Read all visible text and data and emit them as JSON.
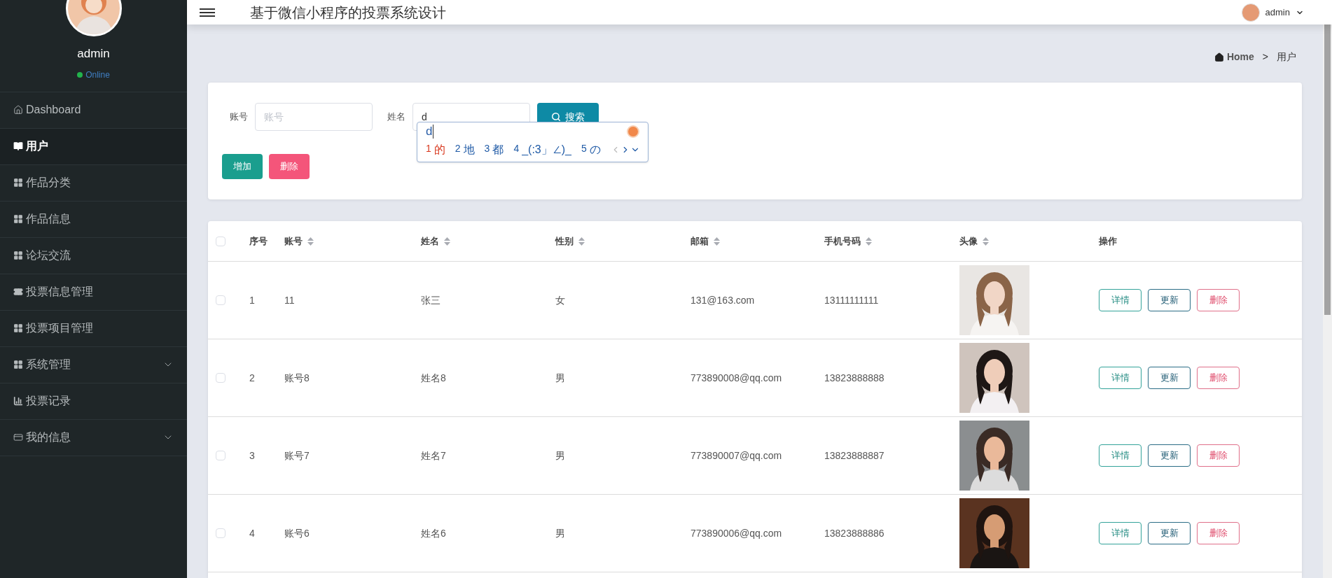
{
  "header": {
    "title": "基于微信小程序的投票系统设计",
    "user": "admin"
  },
  "sidebar": {
    "user": {
      "name": "admin",
      "status": "Online",
      "online": true
    },
    "items": [
      {
        "label": "Dashboard",
        "kind": "home",
        "selected": false,
        "expandable": false
      },
      {
        "label": "用户",
        "kind": "book",
        "selected": true,
        "expandable": false
      },
      {
        "label": "作品分类",
        "kind": "grid",
        "selected": false,
        "expandable": false
      },
      {
        "label": "作品信息",
        "kind": "grid",
        "selected": false,
        "expandable": false
      },
      {
        "label": "论坛交流",
        "kind": "grid",
        "selected": false,
        "expandable": false
      },
      {
        "label": "投票信息管理",
        "kind": "ticket",
        "selected": false,
        "expandable": false
      },
      {
        "label": "投票项目管理",
        "kind": "grid",
        "selected": false,
        "expandable": false
      },
      {
        "label": "系统管理",
        "kind": "grid",
        "selected": false,
        "expandable": true
      },
      {
        "label": "投票记录",
        "kind": "chart",
        "selected": false,
        "expandable": false
      },
      {
        "label": "我的信息",
        "kind": "card",
        "selected": false,
        "expandable": true
      }
    ]
  },
  "breadcrumb": [
    "Home",
    ">",
    "用户"
  ],
  "search": {
    "fields": [
      {
        "label": "账号",
        "placeholder": "账号"
      },
      {
        "label": "姓名",
        "value": "d"
      }
    ],
    "button": "搜索"
  },
  "actions": [
    {
      "label": "增加",
      "kind": "add"
    },
    {
      "label": "删除",
      "kind": "delete"
    }
  ],
  "ime": {
    "input": "d",
    "candidates": [
      {
        "index": "1",
        "text": "的",
        "selected": true
      },
      {
        "index": "2",
        "text": "地",
        "selected": false
      },
      {
        "index": "3",
        "text": "都",
        "selected": false
      },
      {
        "index": "4",
        "text": "_(:3」∠)_",
        "selected": false
      },
      {
        "index": "5",
        "text": "の",
        "selected": false
      }
    ]
  },
  "table": {
    "all_checked": false,
    "columns": [
      {
        "label": "序号",
        "sortable": false
      },
      {
        "label": "账号",
        "sortable": true
      },
      {
        "label": "姓名",
        "sortable": true
      },
      {
        "label": "性别",
        "sortable": true
      },
      {
        "label": "邮箱",
        "sortable": true
      },
      {
        "label": "手机号码",
        "sortable": true
      },
      {
        "label": "头像",
        "sortable": true
      },
      {
        "label": "操作",
        "sortable": false
      }
    ],
    "rows": [
      {
        "checked": false,
        "cells": [
          "1",
          "11",
          "张三",
          "女",
          "131@163.com",
          "13111111111"
        ],
        "photo": {
          "kind": "picture"
        },
        "actions": [
          {
            "label": "详情",
            "kind": "detail"
          },
          {
            "label": "更新",
            "kind": "update"
          },
          {
            "label": "删除",
            "kind": "delete"
          }
        ]
      },
      {
        "checked": false,
        "cells": [
          "2",
          "账号8",
          "姓名8",
          "男",
          "773890008@qq.com",
          "13823888888"
        ],
        "photo": {
          "kind": "picture"
        },
        "actions": [
          {
            "label": "详情",
            "kind": "detail"
          },
          {
            "label": "更新",
            "kind": "update"
          },
          {
            "label": "删除",
            "kind": "delete"
          }
        ]
      },
      {
        "checked": false,
        "cells": [
          "3",
          "账号7",
          "姓名7",
          "男",
          "773890007@qq.com",
          "13823888887"
        ],
        "photo": {
          "kind": "picture"
        },
        "actions": [
          {
            "label": "详情",
            "kind": "detail"
          },
          {
            "label": "更新",
            "kind": "update"
          },
          {
            "label": "删除",
            "kind": "delete"
          }
        ]
      },
      {
        "checked": false,
        "cells": [
          "4",
          "账号6",
          "姓名6",
          "男",
          "773890006@qq.com",
          "13823888886"
        ],
        "photo": {
          "kind": "picture"
        },
        "actions": [
          {
            "label": "详情",
            "kind": "detail"
          },
          {
            "label": "更新",
            "kind": "update"
          },
          {
            "label": "删除",
            "kind": "delete"
          }
        ]
      }
    ]
  }
}
